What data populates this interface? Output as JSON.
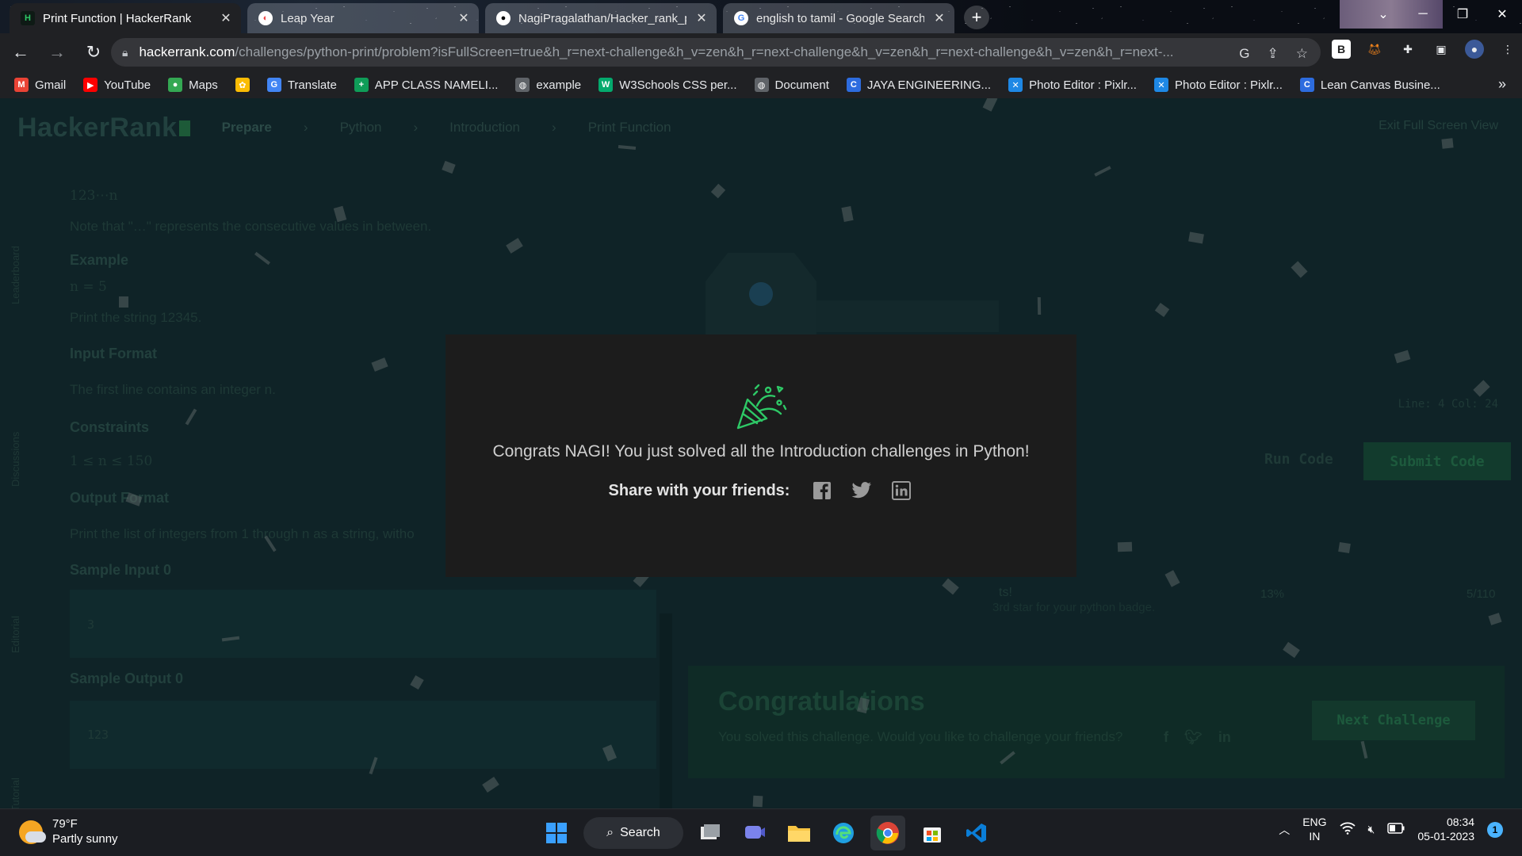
{
  "browser": {
    "tabs": [
      {
        "title": "Print Function | HackerRank",
        "active": true
      },
      {
        "title": "Leap Year",
        "active": false
      },
      {
        "title": "NagiPragalathan/Hacker_rank_p",
        "active": false
      },
      {
        "title": "english to tamil - Google Search",
        "active": false
      }
    ],
    "new_tab_symbol": "+",
    "url_host": "hackerrank.com",
    "url_path": "/challenges/python-print/problem?isFullScreen=true&h_r=next-challenge&h_v=zen&h_r=next-challenge&h_v=zen&h_r=next-challenge&h_v=zen&h_r=next-..."
  },
  "bookmarks": [
    {
      "label": "Gmail",
      "icon": "gmail-icon",
      "color": "#ea4335",
      "glyph": "M"
    },
    {
      "label": "YouTube",
      "icon": "youtube-icon",
      "color": "#ff0000",
      "glyph": "▶"
    },
    {
      "label": "Maps",
      "icon": "maps-icon",
      "color": "#34a853",
      "glyph": "●"
    },
    {
      "label": "",
      "icon": "photos-icon",
      "color": "#fbbc04",
      "glyph": "✿"
    },
    {
      "label": "Translate",
      "icon": "translate-icon",
      "color": "#4285f4",
      "glyph": "G"
    },
    {
      "label": "APP CLASS NAMELI...",
      "icon": "sheets-icon",
      "color": "#0f9d58",
      "glyph": "+"
    },
    {
      "label": "example",
      "icon": "globe-icon",
      "color": "#5f6368",
      "glyph": "◍"
    },
    {
      "label": "W3Schools CSS per...",
      "icon": "w3schools-icon",
      "color": "#04aa6d",
      "glyph": "W"
    },
    {
      "label": "Document",
      "icon": "globe-icon",
      "color": "#5f6368",
      "glyph": "◍"
    },
    {
      "label": "JAYA ENGINEERING...",
      "icon": "canva-icon",
      "color": "#2d6cdf",
      "glyph": "C"
    },
    {
      "label": "Photo Editor : Pixlr...",
      "icon": "pixlr-icon",
      "color": "#1e88e5",
      "glyph": "✕"
    },
    {
      "label": "Photo Editor : Pixlr...",
      "icon": "pixlr-icon",
      "color": "#1e88e5",
      "glyph": "✕"
    },
    {
      "label": "Lean Canvas Busine...",
      "icon": "canva-icon",
      "color": "#2d6cdf",
      "glyph": "C"
    }
  ],
  "bookmarks_more": "»",
  "hackerrank": {
    "logo": "HackerRank",
    "breadcrumb": [
      "Prepare",
      "Python",
      "Introduction",
      "Print Function"
    ],
    "exit_fullscreen": "Exit Full Screen View",
    "rail": [
      "Leaderboard",
      "Discussions",
      "Editorial",
      "Tutorial"
    ],
    "problem": {
      "seq": "123⋯n",
      "note": "Note that \"…\" represents the consecutive values in between.",
      "example_heading": "Example",
      "example_n": "n = 5",
      "example_print": "Print the string 12345.",
      "input_heading": "Input Format",
      "input_text": "The first line contains an integer n.",
      "constraints_heading": "Constraints",
      "constraints_text": "1 ≤ n ≤ 150",
      "output_heading": "Output Format",
      "output_text": "Print the list of integers from 1 through n as a string, witho",
      "sample_input_heading": "Sample Input 0",
      "sample_input": "3",
      "sample_output_heading": "Sample Output 0",
      "sample_output": "123"
    },
    "editor_meta": "Line: 4 Col: 24",
    "run_code": "Run Code",
    "submit_code": "Submit Code",
    "progress_text": "ts!",
    "progress_sub": "3rd star for your python badge.",
    "progress_pct": "13%",
    "progress_count": "5/110",
    "congrats_title": "Congratulations",
    "congrats_sub": "You solved this challenge. Would you like to challenge your friends?",
    "next_challenge": "Next Challenge"
  },
  "modal": {
    "message": "Congrats NAGI! You just solved all the Introduction challenges in Python!",
    "share_label": "Share with your friends:"
  },
  "taskbar": {
    "temperature": "79°F",
    "weather": "Partly sunny",
    "search": "Search",
    "lang_top": "ENG",
    "lang_bottom": "IN",
    "time": "08:34",
    "date": "05-01-2023",
    "notifications": "1"
  },
  "colors": {
    "modal_bg": "#1c1c1c",
    "accent_green": "#2ec866",
    "overlay": "#0f2327"
  }
}
